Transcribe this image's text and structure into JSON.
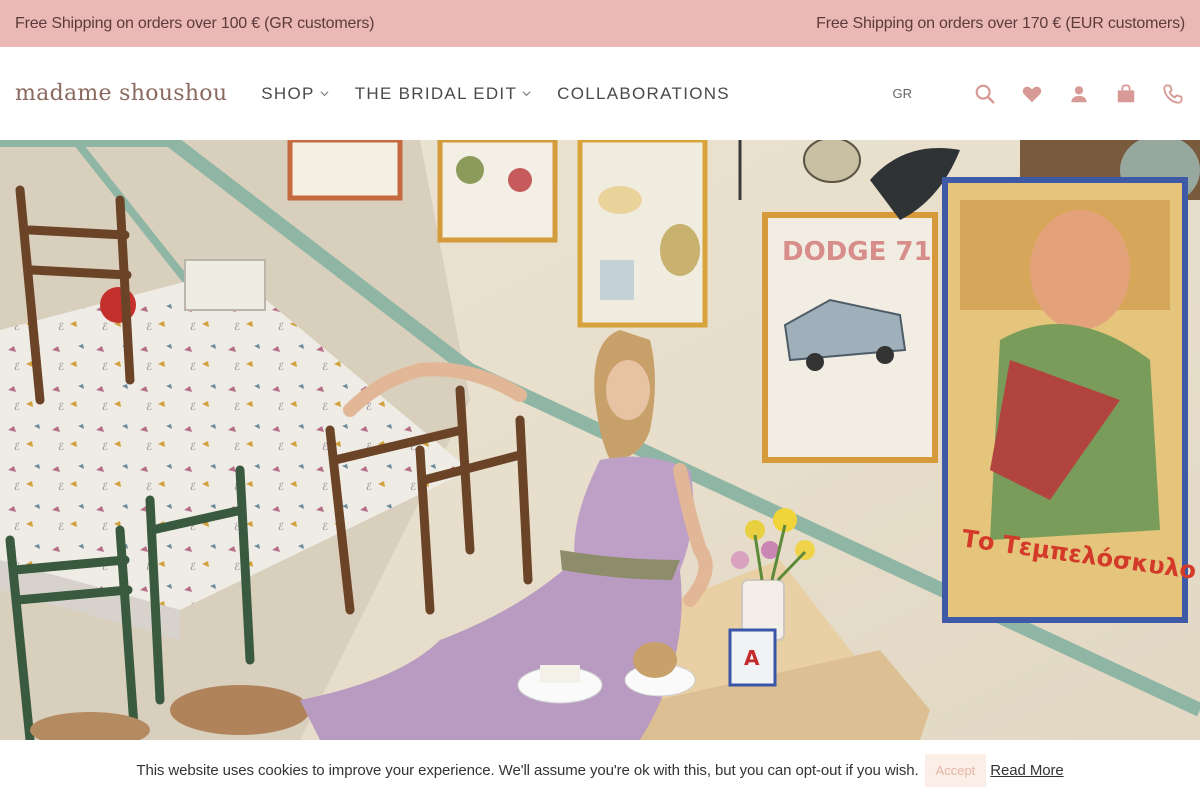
{
  "topbar": {
    "left_text": "Free Shipping on orders over 100 € (GR customers)",
    "right_text": "Free Shipping on orders over 170 € (EUR customers)"
  },
  "header": {
    "logo": "madame shoushou",
    "nav": [
      {
        "label": "SHOP",
        "has_dropdown": true
      },
      {
        "label": "THE BRIDAL EDIT",
        "has_dropdown": true
      },
      {
        "label": "COLLABORATIONS",
        "has_dropdown": false
      }
    ],
    "language": "GR",
    "icons": [
      "search-icon",
      "heart-icon",
      "user-icon",
      "shopping-bag-icon",
      "phone-icon"
    ]
  },
  "hero": {
    "poster_text_1": "DODGE 71",
    "poster_text_2": "Το Τεμπελόσκυλο"
  },
  "cookie": {
    "message": "This website uses cookies to improve your experience. We'll assume you're ok with this, but you can opt-out if you wish.",
    "accept_label": "Accept",
    "read_more_label": "Read More"
  },
  "colors": {
    "topbar_bg": "#eab9b6",
    "accent": "#c98a8a",
    "accept_bg": "#fbeee6"
  }
}
